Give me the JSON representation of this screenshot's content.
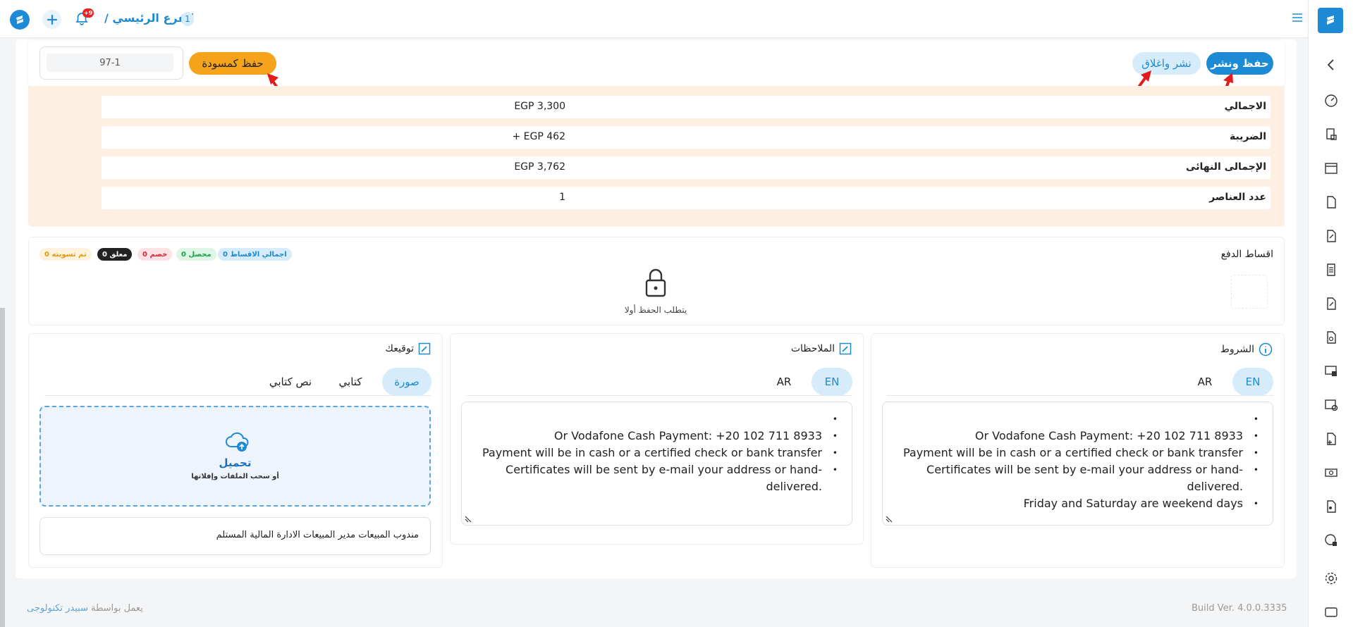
{
  "topbar": {
    "breadcrumb_badge": "1",
    "breadcrumb_title": "الفرع الرئيسي /",
    "notif_count": "+9"
  },
  "actions": {
    "save_publish": "حفظ ونشر",
    "publish_close": "نشر واغلاق",
    "save_draft": "حفظ كمسودة",
    "doc_number": "97-1"
  },
  "summary": {
    "rows": [
      {
        "label": "الاجمالي",
        "value": "EGP 3,300"
      },
      {
        "label": "الضريبة",
        "value": "+ EGP 462"
      },
      {
        "label": "الإجمالى النهائى",
        "value": "EGP 3,762"
      },
      {
        "label": "عدد العناصر",
        "value": "1"
      }
    ]
  },
  "installments": {
    "title": "اقساط الدفع",
    "locked_text": "يتطلب الحفظ أولا",
    "badges": {
      "total": "اجمالي الاقساط 0",
      "collected": "محصل 0",
      "discount": "خصم 0",
      "pending": "معلق 0",
      "settled": "تم تسويته 0"
    }
  },
  "terms": {
    "title": "الشروط",
    "tab_en": "EN",
    "tab_ar": "AR",
    "lines": [
      "",
      "Or Vodafone Cash Payment: +20 102 711 8933",
      "Payment will be in cash or a certified check or bank transfer",
      "Certificates will be sent by e-mail your address or hand-delivered.",
      "Friday and Saturday are weekend days"
    ]
  },
  "notes": {
    "title": "الملاحظات",
    "tab_en": "EN",
    "tab_ar": "AR",
    "lines": [
      "",
      "Or Vodafone Cash Payment: +20 102 711 8933",
      "Payment will be in cash or a certified check or bank transfer",
      "Certificates will be sent by e-mail your address or hand-delivered."
    ]
  },
  "signature": {
    "title": "توقيعك",
    "tab_image": "صورة",
    "tab_written": "كتابي",
    "tab_text": "نص كتابي",
    "upload_title": "تحميل",
    "upload_hint": "أو سحب الملفات وإفلاتها",
    "signers": "مندوب المبيعات مدير المبيعات الادارة المالية المستلم"
  },
  "footer": {
    "build": "Build Ver. 4.0.0.3335",
    "powered_prefix": "يعمل بواسطة",
    "powered_brand": "سبيدر تكنولوجى"
  },
  "colors": {
    "primary": "#1c8ad4",
    "light_blue": "#d6ecfa",
    "orange": "#f4a31b",
    "summary_bg": "#fdf0e2",
    "arrow_red": "#e31b1b"
  }
}
